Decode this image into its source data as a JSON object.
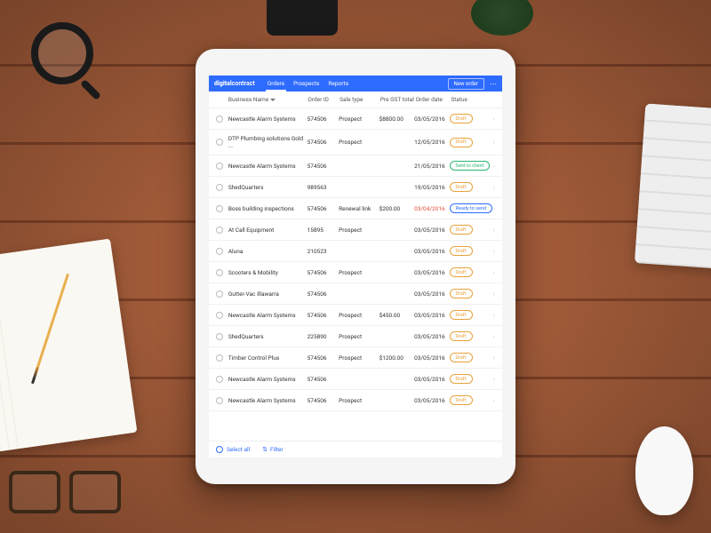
{
  "brand": {
    "part1": "digital",
    "part2": "contract"
  },
  "nav": {
    "orders": "Orders",
    "prospects": "Prospects",
    "reports": "Reports"
  },
  "newOrder": "New order",
  "columns": {
    "name": "Business Name",
    "id": "Order ID",
    "type": "Sale type",
    "total": "Pre GST total",
    "date": "Order date",
    "status": "Status"
  },
  "footer": {
    "selectAll": "Select all",
    "filter": "Filter"
  },
  "statusLabels": {
    "draft": "Draft",
    "sent": "Sent to client",
    "ready": "Ready to send"
  },
  "rows": [
    {
      "name": "Newcastle Alarm Systems",
      "id": "574506",
      "type": "Prospect",
      "total": "$8800.00",
      "date": "03/05/2016",
      "status": "draft"
    },
    {
      "name": "DTP Plumbing solutions Gold ...",
      "id": "574506",
      "type": "Prospect",
      "total": "",
      "date": "12/05/2016",
      "status": "draft"
    },
    {
      "name": "Newcastle Alarm Systems",
      "id": "574506",
      "type": "",
      "total": "",
      "date": "21/05/2016",
      "status": "sent"
    },
    {
      "name": "ShedQuarters",
      "id": "989563",
      "type": "",
      "total": "",
      "date": "19/05/2016",
      "status": "draft"
    },
    {
      "name": "Boss building inspections",
      "id": "574506",
      "type": "Renewal link",
      "total": "$200.00",
      "date": "03/04/2016",
      "dateRed": true,
      "status": "ready"
    },
    {
      "name": "At Call Equipment",
      "id": "15895",
      "type": "Prospect",
      "total": "",
      "date": "03/05/2016",
      "status": "draft"
    },
    {
      "name": "Aluna",
      "id": "210523",
      "type": "",
      "total": "",
      "date": "03/05/2016",
      "status": "draft"
    },
    {
      "name": "Scooters & Mobility",
      "id": "574506",
      "type": "Prospect",
      "total": "",
      "date": "03/05/2016",
      "status": "draft"
    },
    {
      "name": "Gutter-Vac Illawarra",
      "id": "574506",
      "type": "",
      "total": "",
      "date": "03/05/2016",
      "status": "draft"
    },
    {
      "name": "Newcastle Alarm Systems",
      "id": "574506",
      "type": "Prospect",
      "total": "$450.00",
      "date": "03/05/2016",
      "status": "draft"
    },
    {
      "name": "ShedQuarters",
      "id": "225890",
      "type": "Prospect",
      "total": "",
      "date": "03/05/2016",
      "status": "draft"
    },
    {
      "name": "Timber Control Plus",
      "id": "574506",
      "type": "Prospect",
      "total": "$1200.00",
      "date": "03/05/2016",
      "status": "draft"
    },
    {
      "name": "Newcastle Alarm Systems",
      "id": "574506",
      "type": "",
      "total": "",
      "date": "03/05/2016",
      "status": "draft"
    },
    {
      "name": "Newcastle Alarm Systems",
      "id": "574506",
      "type": "Prospect",
      "total": "",
      "date": "03/05/2016",
      "status": "draft"
    }
  ]
}
